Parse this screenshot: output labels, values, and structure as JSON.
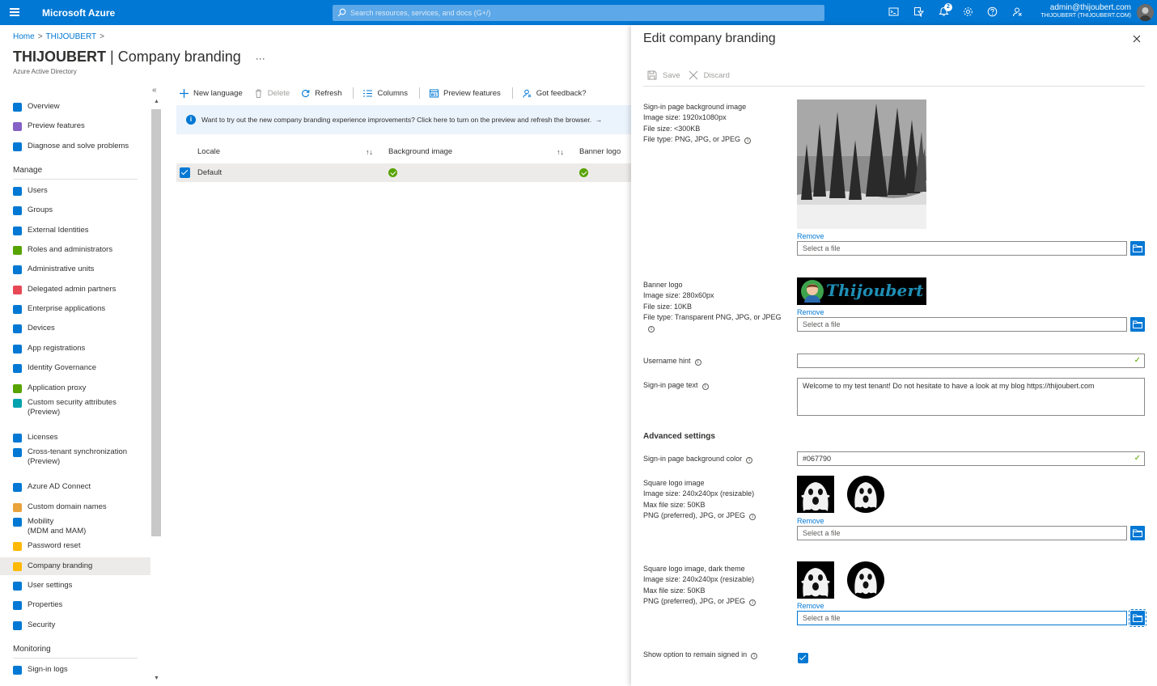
{
  "topbar": {
    "brand": "Microsoft Azure",
    "search_placeholder": "Search resources, services, and docs (G+/)",
    "notification_count": "2",
    "account_email": "admin@thijoubert.com",
    "account_tenant": "THIJOUBERT (THIJOUBERT.COM)",
    "icons": [
      "cloud-shell-icon",
      "directory-filter-icon",
      "notifications-icon",
      "settings-icon",
      "help-icon",
      "feedback-icon"
    ]
  },
  "breadcrumb": {
    "home": "Home",
    "tenant": "THIJOUBERT"
  },
  "header": {
    "title_bold": "THIJOUBERT",
    "title_rest": " | Company branding",
    "more": "···",
    "subtitle": "Azure Active Directory"
  },
  "sidebar": {
    "collapse": "«",
    "top_items": [
      {
        "label": "Overview",
        "icon": "info-icon",
        "color": "#0078d4"
      },
      {
        "label": "Preview features",
        "icon": "preview-icon",
        "color": "#8661c5"
      },
      {
        "label": "Diagnose and solve problems",
        "icon": "wrench-icon",
        "color": "#0078d4"
      }
    ],
    "manage_header": "Manage",
    "manage_items": [
      {
        "label": "Users",
        "icon": "user-icon",
        "color": "#0078d4"
      },
      {
        "label": "Groups",
        "icon": "group-icon",
        "color": "#0078d4"
      },
      {
        "label": "External Identities",
        "icon": "external-identities-icon",
        "color": "#0078d4"
      },
      {
        "label": "Roles and administrators",
        "icon": "roles-icon",
        "color": "#57a300"
      },
      {
        "label": "Administrative units",
        "icon": "admin-units-icon",
        "color": "#0078d4"
      },
      {
        "label": "Delegated admin partners",
        "icon": "partners-icon",
        "color": "#e74856"
      },
      {
        "label": "Enterprise applications",
        "icon": "enterprise-apps-icon",
        "color": "#0078d4"
      },
      {
        "label": "Devices",
        "icon": "devices-icon",
        "color": "#0078d4"
      },
      {
        "label": "App registrations",
        "icon": "app-registrations-icon",
        "color": "#0078d4"
      },
      {
        "label": "Identity Governance",
        "icon": "governance-icon",
        "color": "#0078d4"
      },
      {
        "label": "Application proxy",
        "icon": "app-proxy-icon",
        "color": "#57a300"
      },
      {
        "label": "Custom security attributes (Preview)",
        "icon": "security-attributes-icon",
        "color": "#00a2ad"
      },
      {
        "label": "Licenses",
        "icon": "licenses-icon",
        "color": "#0078d4"
      },
      {
        "label": "Cross-tenant synchronization (Preview)",
        "icon": "sync-icon",
        "color": "#0078d4"
      },
      {
        "label": "Azure AD Connect",
        "icon": "ad-connect-icon",
        "color": "#0078d4"
      },
      {
        "label": "Custom domain names",
        "icon": "domain-icon",
        "color": "#e8a33d"
      },
      {
        "label": "Mobility (MDM and MAM)",
        "icon": "mobility-icon",
        "color": "#0078d4"
      },
      {
        "label": "Password reset",
        "icon": "key-icon",
        "color": "#ffb900"
      },
      {
        "label": "Company branding",
        "icon": "branding-icon",
        "color": "#ffb900"
      },
      {
        "label": "User settings",
        "icon": "user-settings-icon",
        "color": "#0078d4"
      },
      {
        "label": "Properties",
        "icon": "properties-icon",
        "color": "#0078d4"
      },
      {
        "label": "Security",
        "icon": "shield-icon",
        "color": "#0078d4"
      }
    ],
    "monitoring_header": "Monitoring",
    "monitoring_items": [
      {
        "label": "Sign-in logs",
        "icon": "sign-in-logs-icon",
        "color": "#0078d4"
      }
    ]
  },
  "toolbar": {
    "new_language": "New language",
    "delete": "Delete",
    "refresh": "Refresh",
    "columns": "Columns",
    "preview_features": "Preview features",
    "feedback": "Got feedback?"
  },
  "info_bar": {
    "text": "Want to try out the new company branding experience improvements? Click here to turn on the preview and refresh the browser.",
    "arrow": "→"
  },
  "grid": {
    "columns": [
      "Locale",
      "Background image",
      "Banner logo"
    ],
    "rows": [
      {
        "locale": "Default",
        "background_image": true,
        "banner_logo": true,
        "selected": true
      }
    ]
  },
  "panel": {
    "title": "Edit company branding",
    "save": "Save",
    "discard": "Discard",
    "bg_image": {
      "label": "Sign-in page background image",
      "size": "Image size: 1920x1080px",
      "file_size": "File size: <300KB",
      "file_type": "File type: PNG, JPG, or JPEG",
      "remove": "Remove",
      "placeholder": "Select a file"
    },
    "banner_logo": {
      "label": "Banner logo",
      "size": "Image size: 280x60px",
      "file_size": "File size: 10KB",
      "file_type": "File type: Transparent PNG, JPG, or JPEG",
      "logo_text": "Thijoubert",
      "remove": "Remove",
      "placeholder": "Select a file"
    },
    "username_hint": {
      "label": "Username hint",
      "value": ""
    },
    "sign_in_text": {
      "label": "Sign-in page text",
      "value": "Welcome to my test tenant! Do not hesitate to have a look at my blog https://thijoubert.com"
    },
    "advanced_header": "Advanced settings",
    "bg_color": {
      "label": "Sign-in page background color",
      "value": "#067790"
    },
    "square_logo": {
      "label": "Square logo image",
      "size": "Image size: 240x240px (resizable)",
      "file_size": "Max file size: 50KB",
      "file_type": "PNG (preferred), JPG, or JPEG",
      "remove": "Remove",
      "placeholder": "Select a file"
    },
    "square_logo_dark": {
      "label": "Square logo image, dark theme",
      "size": "Image size: 240x240px (resizable)",
      "file_size": "Max file size: 50KB",
      "file_type": "PNG (preferred), JPG, or JPEG",
      "remove": "Remove",
      "placeholder": "Select a file"
    },
    "remain_signed_in": {
      "label": "Show option to remain signed in",
      "checked": true
    }
  },
  "colors": {
    "accent": "#0078d4",
    "success": "#57a300",
    "selected_row": "#edebe9"
  }
}
